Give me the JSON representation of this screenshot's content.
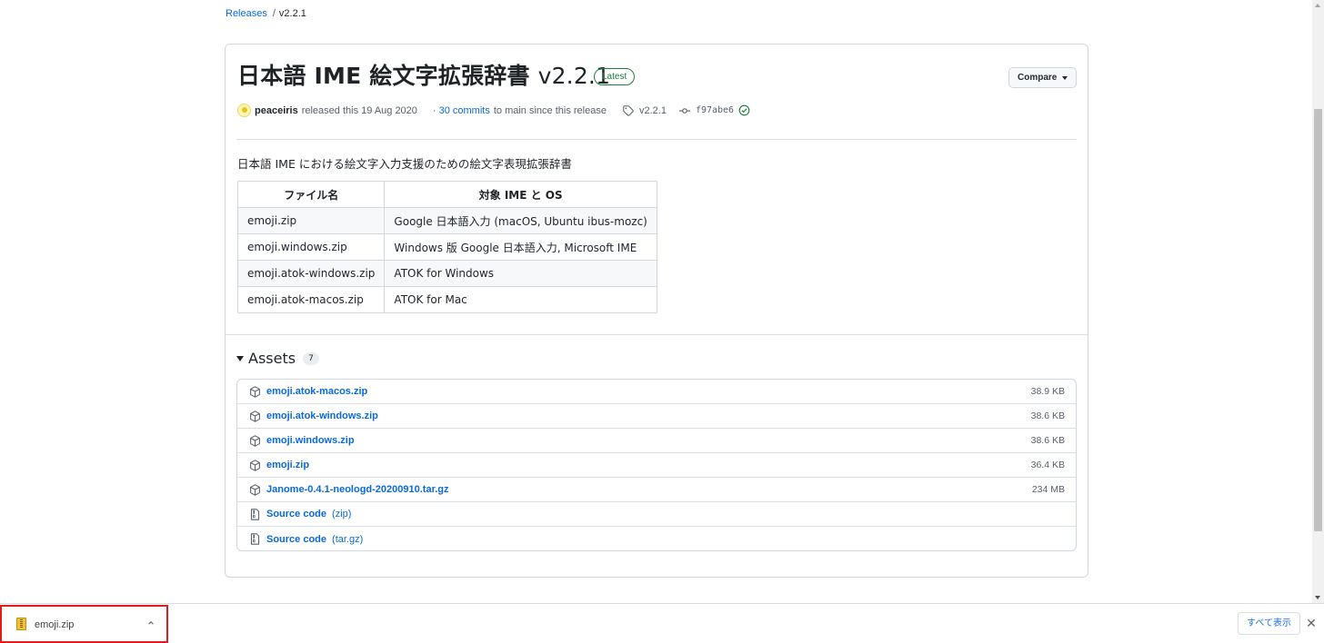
{
  "breadcrumb": {
    "root": "Releases",
    "sep": "/",
    "current": "v2.2.1"
  },
  "release": {
    "title": "日本語 IME 絵文字拡張辞書",
    "version": "v2.2.1",
    "badge": "Latest",
    "compare_label": "Compare",
    "author": "peaceiris",
    "released_text": "released this 19 Aug 2020",
    "commits_prefix": "·",
    "commits_link": "30 commits",
    "commits_suffix": "to main since this release",
    "tag": "v2.2.1",
    "commit_sha": "f97abe6"
  },
  "body": {
    "description": "日本語 IME における絵文字入力支援のための絵文字表現拡張辞書",
    "table": {
      "headers": [
        "ファイル名",
        "対象 IME と OS"
      ],
      "rows": [
        [
          "emoji.zip",
          "Google 日本語入力 (macOS, Ubuntu ibus-mozc)"
        ],
        [
          "emoji.windows.zip",
          "Windows 版 Google 日本語入力, Microsoft IME"
        ],
        [
          "emoji.atok-windows.zip",
          "ATOK for Windows"
        ],
        [
          "emoji.atok-macos.zip",
          "ATOK for Mac"
        ]
      ]
    }
  },
  "assets": {
    "heading": "Assets",
    "count": "7",
    "items": [
      {
        "name": "emoji.atok-macos.zip",
        "size": "38.9 KB",
        "icon": "package-icon"
      },
      {
        "name": "emoji.atok-windows.zip",
        "size": "38.6 KB",
        "icon": "package-icon"
      },
      {
        "name": "emoji.windows.zip",
        "size": "38.6 KB",
        "icon": "package-icon"
      },
      {
        "name": "emoji.zip",
        "size": "36.4 KB",
        "icon": "package-icon"
      },
      {
        "name": "Janome-0.4.1-neologd-20200910.tar.gz",
        "size": "234 MB",
        "icon": "package-icon"
      },
      {
        "name": "Source code",
        "format": "(zip)",
        "icon": "file-zip-icon"
      },
      {
        "name": "Source code",
        "format": "(tar.gz)",
        "icon": "file-zip-icon"
      }
    ]
  },
  "download_bar": {
    "file_name": "emoji.zip",
    "show_all": "すべて表示",
    "close": "✕"
  },
  "colors": {
    "link": "#0969da",
    "latest_green": "#1a7f37",
    "highlight_red": "#e11b1b"
  }
}
